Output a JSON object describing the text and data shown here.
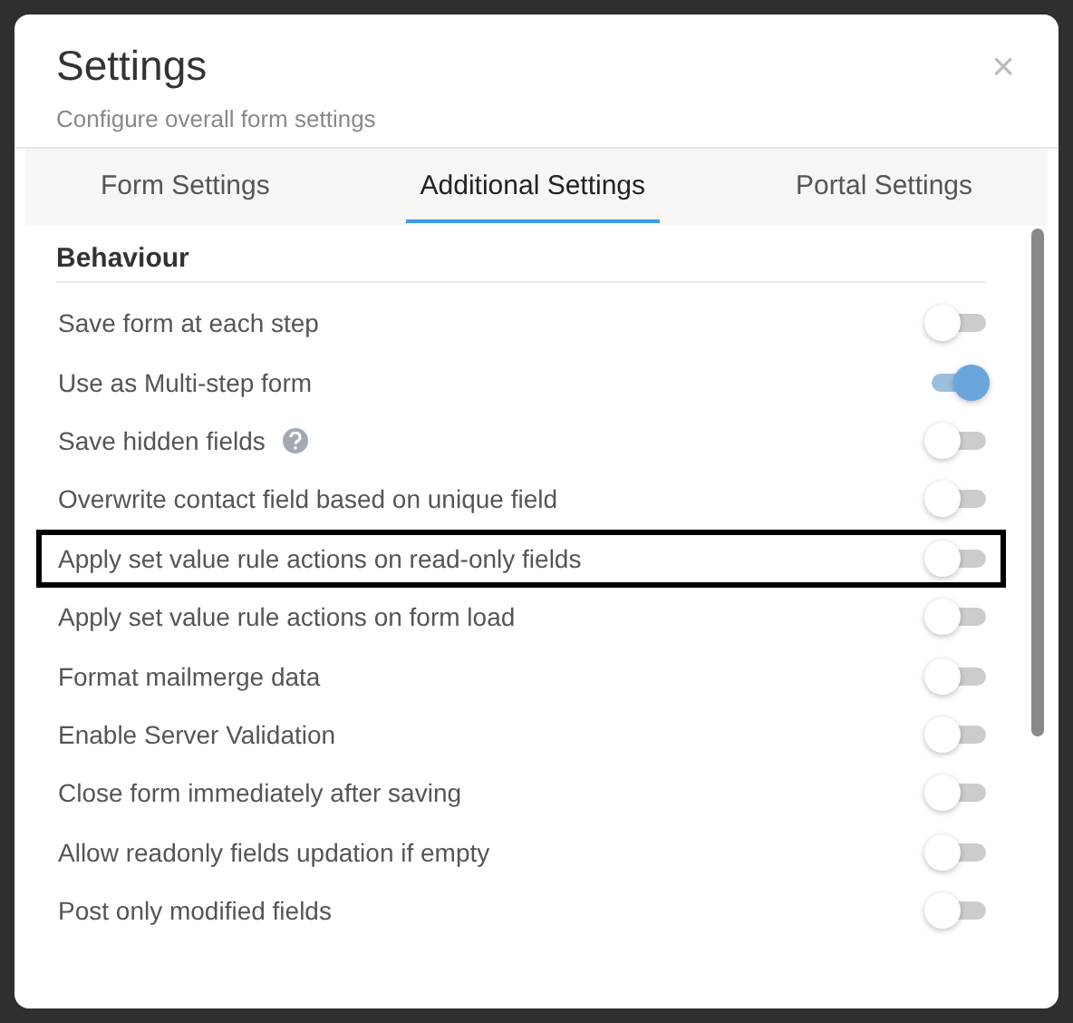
{
  "dialog": {
    "title": "Settings",
    "subtitle": "Configure overall form settings",
    "close": "×"
  },
  "tabs": [
    {
      "label": "Form Settings",
      "selected": false
    },
    {
      "label": "Additional Settings",
      "selected": true
    },
    {
      "label": "Portal Settings",
      "selected": false
    }
  ],
  "section": {
    "heading": "Behaviour"
  },
  "settings": [
    {
      "label": "Save form at each step",
      "on": false,
      "help": false,
      "highlighted": false
    },
    {
      "label": "Use as Multi-step form",
      "on": true,
      "help": false,
      "highlighted": false
    },
    {
      "label": "Save hidden fields",
      "on": false,
      "help": true,
      "highlighted": false
    },
    {
      "label": "Overwrite contact field based on unique field",
      "on": false,
      "help": false,
      "highlighted": false
    },
    {
      "label": "Apply set value rule actions on read-only fields",
      "on": false,
      "help": false,
      "highlighted": true
    },
    {
      "label": "Apply set value rule actions on form load",
      "on": false,
      "help": false,
      "highlighted": false
    },
    {
      "label": "Format mailmerge data",
      "on": false,
      "help": false,
      "highlighted": false
    },
    {
      "label": "Enable Server Validation",
      "on": false,
      "help": false,
      "highlighted": false
    },
    {
      "label": "Close form immediately after saving",
      "on": false,
      "help": false,
      "highlighted": false
    },
    {
      "label": "Allow readonly fields updation if empty",
      "on": false,
      "help": false,
      "highlighted": false
    },
    {
      "label": "Post only modified fields",
      "on": false,
      "help": false,
      "highlighted": false
    }
  ]
}
